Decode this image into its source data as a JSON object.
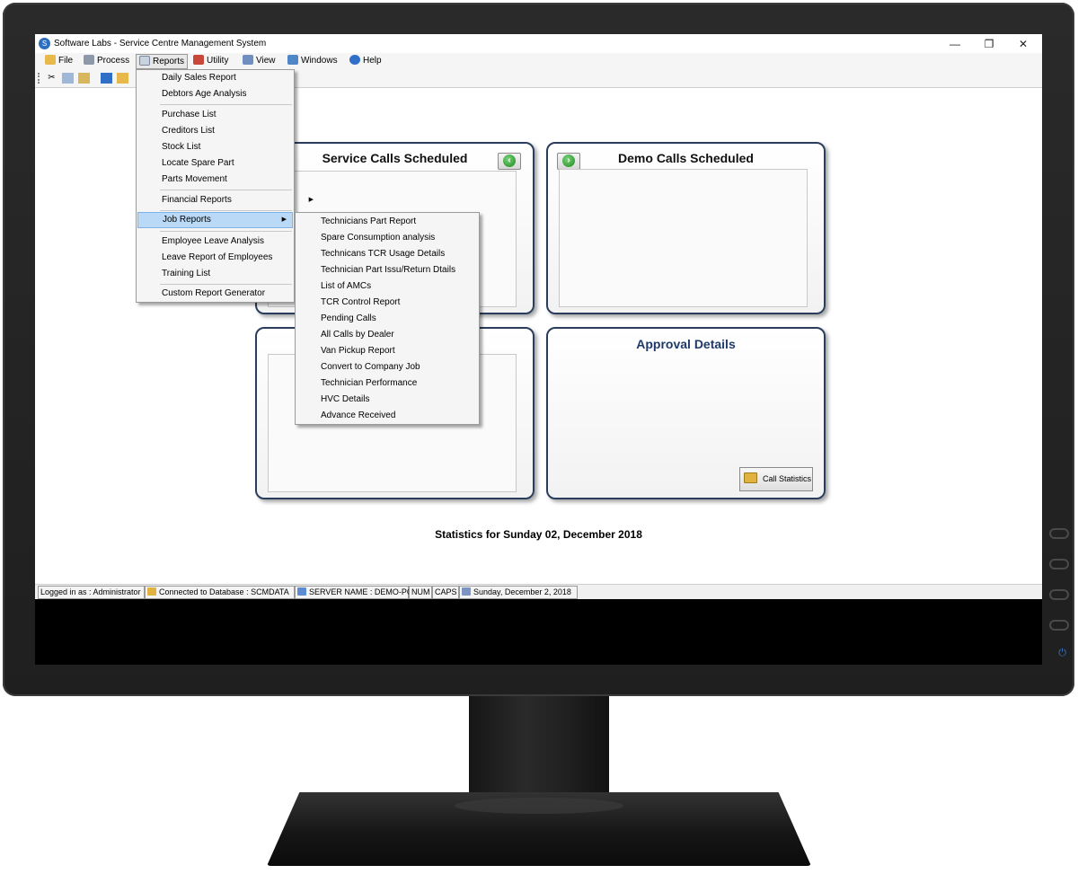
{
  "window": {
    "title": "Software Labs - Service Centre Management System",
    "controls": {
      "minimize": "—",
      "restore": "❐",
      "close": "✕"
    }
  },
  "menubar": {
    "items": [
      {
        "label": "File",
        "icon": "folder-open-icon"
      },
      {
        "label": "Process",
        "icon": "process-icon"
      },
      {
        "label": "Reports",
        "icon": "reports-icon"
      },
      {
        "label": "Utility",
        "icon": "wrench-icon"
      },
      {
        "label": "View",
        "icon": "view-grid-icon"
      },
      {
        "label": "Windows",
        "icon": "windows-icon"
      },
      {
        "label": "Help",
        "icon": "help-icon"
      }
    ]
  },
  "toolbar": {
    "icons": [
      "cut-icon",
      "copy-icon",
      "paste-icon",
      "folder-icon",
      "folder-open-icon"
    ]
  },
  "reports_menu": {
    "items": [
      "Daily Sales Report",
      "Debtors Age Analysis",
      "Purchase List",
      "Creditors List",
      "Stock List",
      "Locate Spare Part",
      "Parts Movement",
      "Financial Reports",
      "Job Reports",
      "Employee Leave Analysis",
      "Leave Report of Employees",
      "Training List",
      "Custom Report Generator"
    ],
    "highlighted": "Job Reports"
  },
  "job_reports_menu": {
    "items": [
      "Technicians Part Report",
      "Spare Consumption analysis",
      "Technicans TCR Usage Details",
      "Technician Part Issu/Return Dtails",
      "List of AMCs",
      "TCR Control Report",
      "Pending Calls",
      "All Calls by Dealer",
      "Van Pickup Report",
      "Convert to Company Job",
      "Technician Performance",
      "HVC Details",
      "Advance Received"
    ]
  },
  "panels": {
    "service_calls": {
      "title": "Service Calls Scheduled"
    },
    "demo_calls": {
      "title": "Demo Calls Scheduled"
    },
    "approval": {
      "title": "Approval Details",
      "button": "Call Statistics"
    }
  },
  "stats_text": "Statistics for Sunday 02, December 2018",
  "statusbar": {
    "logged_in": "Logged in as : Administrator",
    "database": "Connected to Database : SCMDATA",
    "server": "SERVER NAME : DEMO-PC",
    "num": "NUM",
    "caps": "CAPS",
    "date": "Sunday, December 2, 2018"
  },
  "colors": {
    "panel_border": "#2a3d5c",
    "menu_highlight": "#b9d9f7",
    "approval_title": "#1f3a66"
  }
}
